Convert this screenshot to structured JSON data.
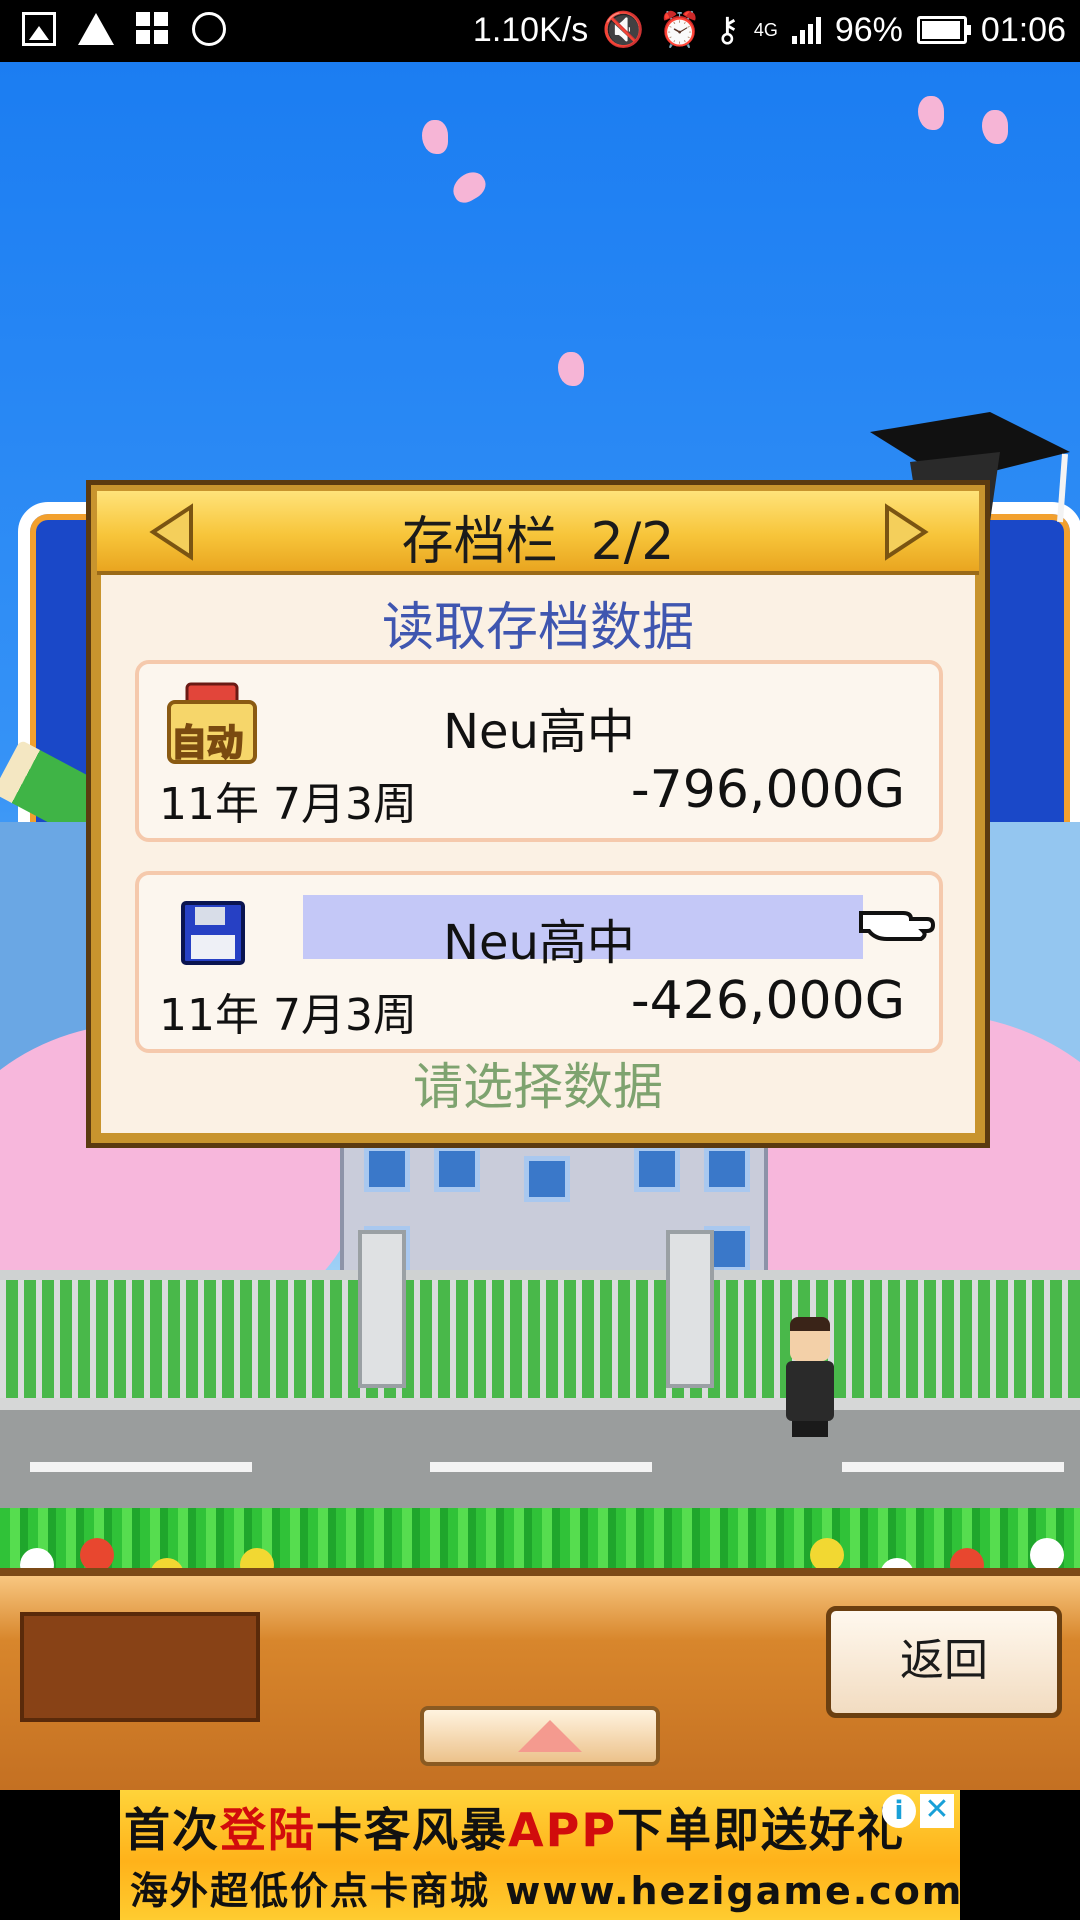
{
  "status_bar": {
    "net_speed": "1.10K/s",
    "network": "4G",
    "battery": "96%",
    "time": "01:06",
    "left_icons": [
      "image-icon",
      "warning-icon",
      "apps-icon",
      "chat-icon"
    ],
    "right_icons": [
      "mute-icon",
      "alarm-icon",
      "key-icon",
      "signal-icon",
      "battery-icon"
    ]
  },
  "dialog": {
    "title": "存档栏  2/2",
    "subtitle": "读取存档数据",
    "hint": "请选择数据",
    "slots": [
      {
        "name": "Neu高中",
        "date": "11年 7月3周",
        "money": "-796,000G",
        "badge": "自动",
        "icon": "auto-save-icon"
      },
      {
        "name": "Neu高中",
        "date": "11年 7月3周",
        "money": "-426,000G",
        "icon": "floppy-disk-icon",
        "selected": true
      }
    ],
    "colors": {
      "header": "#f7c53a",
      "subtitle": "#3f56b0",
      "hint": "#7ea36f",
      "highlight": "#c4c8f7"
    }
  },
  "bottom_bar": {
    "back_label": "返回"
  },
  "ad": {
    "line1_a": "首次",
    "line1_b": "登陆",
    "line1_c": "卡客风暴",
    "line1_d": "APP",
    "line1_e": "下单即送好礼",
    "line2": "海外超低价点卡商城 www.hezigame.com",
    "info": "i",
    "close": "✕"
  }
}
